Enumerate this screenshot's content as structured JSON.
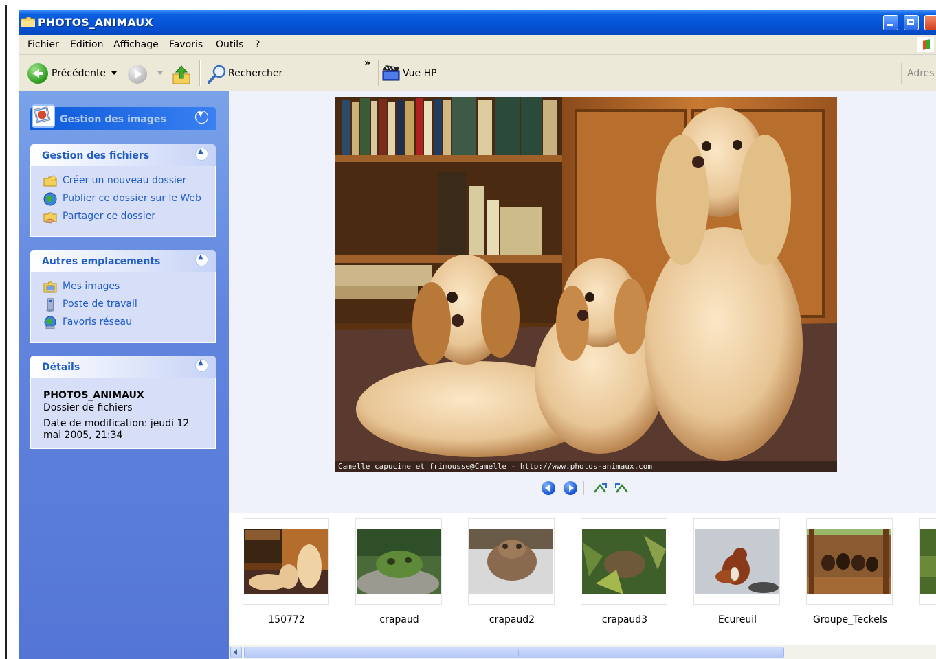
{
  "window": {
    "title": "PHOTOS_ANIMAUX"
  },
  "menu": [
    "Fichier",
    "Edition",
    "Affichage",
    "Favoris",
    "Outils",
    "?"
  ],
  "toolbar": {
    "back_label": "Précédente",
    "search_label": "Rechercher",
    "chevron": "»",
    "vue_label": "Vue HP",
    "address_label": "Adres"
  },
  "sidebar": {
    "images_task": {
      "title": "Gestion des images"
    },
    "file_tasks": {
      "title": "Gestion des fichiers",
      "items": [
        "Créer un nouveau dossier",
        "Publier ce dossier sur le Web",
        "Partager ce dossier"
      ]
    },
    "other_places": {
      "title": "Autres emplacements",
      "items": [
        "Mes images",
        "Poste de travail",
        "Favoris réseau"
      ]
    },
    "details": {
      "title": "Détails",
      "name": "PHOTOS_ANIMAUX",
      "type": "Dossier de fichiers",
      "date": "Date de modification: jeudi 12 mai 2005, 21:34"
    }
  },
  "preview": {
    "caption": "Camelle capucine et frimousse@Camelle - http://www.photos-animaux.com"
  },
  "thumbnails": [
    "150772",
    "crapaud",
    "crapaud2",
    "crapaud3",
    "Ecureuil",
    "Groupe_Teckels"
  ],
  "colors": {
    "titlebar": "#0553d5",
    "sidebar": "#6185df",
    "link": "#215dc6"
  }
}
